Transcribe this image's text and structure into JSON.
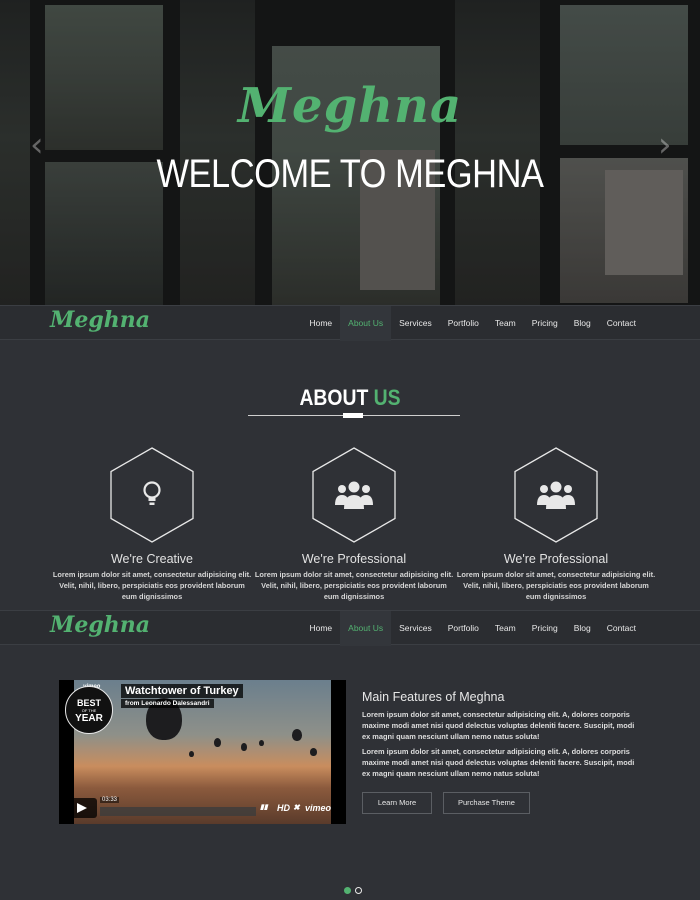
{
  "brand": {
    "script_logo": "Meghna",
    "accent_color": "#53b271"
  },
  "hero": {
    "script_title": "Meghna",
    "headline": "WELCOME TO MEGHNA",
    "prev_icon": "chevron-left-icon",
    "next_icon": "chevron-right-icon"
  },
  "nav": {
    "items": [
      {
        "label": "Home"
      },
      {
        "label": "About Us",
        "active": true
      },
      {
        "label": "Services"
      },
      {
        "label": "Portfolio"
      },
      {
        "label": "Team"
      },
      {
        "label": "Pricing"
      },
      {
        "label": "Blog"
      },
      {
        "label": "Contact"
      }
    ]
  },
  "about": {
    "title_main": "ABOUT",
    "title_accent": "US",
    "features": [
      {
        "icon": "lightbulb-icon",
        "title": "We're Creative",
        "text": "Lorem ipsum dolor sit amet, consectetur adipisicing elit. Velit, nihil, libero, perspiciatis eos provident laborum eum dignissimos"
      },
      {
        "icon": "team-icon",
        "title": "We're Professional",
        "text": "Lorem ipsum dolor sit amet, consectetur adipisicing elit. Velit, nihil, libero, perspiciatis eos provident laborum eum dignissimos"
      },
      {
        "icon": "team-icon",
        "title": "We're Professional",
        "text": "Lorem ipsum dolor sit amet, consectetur adipisicing elit. Velit, nihil, libero, perspiciatis eos provident laborum eum dignissimos"
      }
    ]
  },
  "video": {
    "brand": "vimeo",
    "title": "Watchtower of Turkey",
    "author": "from Leonardo Dalessandri",
    "badge_line1": "BEST",
    "badge_line2": "YEAR",
    "badge_small": "OF THE",
    "time": "03:33",
    "hd_label": "HD",
    "footer_brand": "vimeo"
  },
  "features_block": {
    "title": "Main Features of Meghna",
    "paragraph1": "Lorem ipsum dolor sit amet, consectetur adipisicing elit. A, dolores corporis maxime modi amet nisi quod delectus voluptas deleniti facere. Suscipit, modi ex magni quam nesciunt ullam nemo natus soluta!",
    "paragraph2": "Lorem ipsum dolor sit amet, consectetur adipisicing elit. A, dolores corporis maxime modi amet nisi quod delectus voluptas deleniti facere. Suscipit, modi ex magni quam nesciunt ullam nemo natus soluta!",
    "learn_more": "Learn More",
    "purchase": "Purchase Theme"
  },
  "slider": {
    "dots": 2,
    "active_index": 0
  }
}
